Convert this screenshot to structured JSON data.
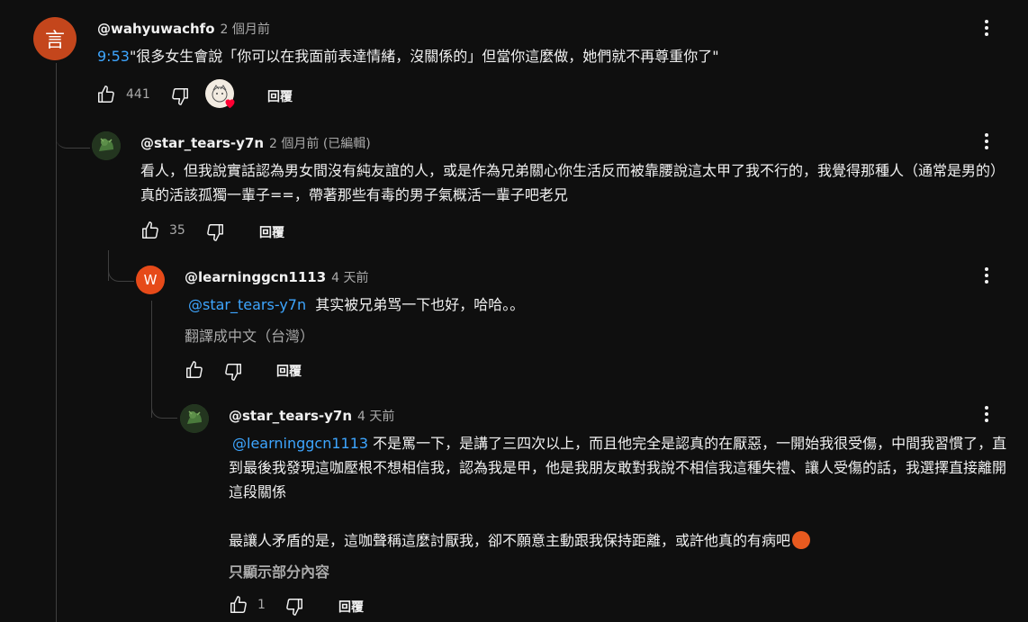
{
  "comments": [
    {
      "avatar_letter": "言",
      "avatar_color": "#c4461c",
      "handle": "@wahyuwachfo",
      "time": "2 個月前",
      "timestamp_link": "9:53",
      "text": "\"很多女生會說「你可以在我面前表達情緒，沒關係的」但當你這麼做，她們就不再尊重你了\"",
      "likes": "441",
      "reply_label": "回覆"
    },
    {
      "handle": "@star_tears-y7n",
      "time": "2 個月前 (已編輯)",
      "text": "看人，但我說實話認為男女間沒有純友誼的人，或是作為兄弟關心你生活反而被靠腰說這太甲了我不行的，我覺得那種人（通常是男的）真的活該孤獨一輩子==，帶著那些有毒的男子氣概活一輩子吧老兄",
      "likes": "35",
      "reply_label": "回覆"
    },
    {
      "avatar_letter": "W",
      "avatar_color": "#e64a19",
      "handle": "@learninggcn1113",
      "time": "4 天前",
      "mention": "@star_tears-y7n",
      "text": "  其实被兄弟骂一下也好，哈哈。。",
      "translate_label": "翻譯成中文（台灣）",
      "reply_label": "回覆"
    },
    {
      "handle": "@star_tears-y7n",
      "time": "4 天前",
      "mention": "@learninggcn1113",
      "text_first": " 不是罵一下，是講了三四次以上，而且他完全是認真的在厭惡，一開始我很受傷，中間我習慣了，直到最後我發現這咖壓根不想相信我，認為我是甲，他是我朋友敢對我說不相信我這種失禮、讓人受傷的話，我選擇直接離開這段關係",
      "text_second": "最讓人矛盾的是，這咖聲稱這麼討厭我，卻不願意主動跟我保持距離，或許他真的有病吧",
      "emoji": "😡",
      "read_more": "只顯示部分內容",
      "likes": "1",
      "reply_label": "回覆"
    }
  ],
  "icons": {
    "like": "thumbs-up-icon",
    "dislike": "thumbs-down-icon",
    "more": "more-vert-icon",
    "heart": "creator-heart-icon"
  },
  "colors": {
    "background": "#0f0f0f",
    "link": "#3ea6ff",
    "secondary_text": "#aaaaaa",
    "heart": "#ff0033"
  }
}
